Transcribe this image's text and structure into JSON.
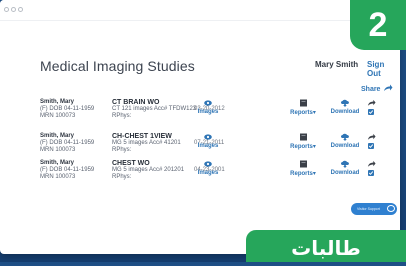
{
  "window": {
    "title": ""
  },
  "step": {
    "number": "2"
  },
  "header": {
    "title": "Medical Imaging Studies",
    "user_name": "Mary Smith",
    "sign_out": "Sign Out"
  },
  "toolbar": {
    "share_label": "Share"
  },
  "columns": {
    "images": "Images",
    "reports": "Reports",
    "download": "Download"
  },
  "studies": [
    {
      "patient_name": "Smith, Mary",
      "patient_info": "(F) DOB 04-11-1959",
      "mrn": "MRN 100073",
      "study_name": "CT BRAIN WO",
      "study_info": "CT 121 images  Acc# TFDW123",
      "phys": "RPhys:",
      "date": "03-20-2012"
    },
    {
      "patient_name": "Smith, Mary",
      "patient_info": "(F) DOB 04-11-1959",
      "mrn": "MRN 100073",
      "study_name": "CH-CHEST 1VIEW",
      "study_info": "MG 5 images  Acc# 41201",
      "phys": "RPhys:",
      "date": "07-21-2011"
    },
    {
      "patient_name": "Smith, Mary",
      "patient_info": "(F) DOB 04-11-1959",
      "mrn": "MRN 100073",
      "study_name": "CHEST WO",
      "study_info": "MG 5 images  Acc# 201201",
      "phys": "RPhys:",
      "date": "04-23-2001"
    }
  ],
  "support": {
    "label": "Visitor Support"
  },
  "banner": {
    "text": "طالبات"
  },
  "colors": {
    "accent": "#2f75b5",
    "badge_green": "#26a65b",
    "background": "#1e4f86"
  },
  "icons": [
    "eye-icon",
    "report-icon",
    "download-icon",
    "share-arrow-icon",
    "chat-bubble-icon"
  ]
}
